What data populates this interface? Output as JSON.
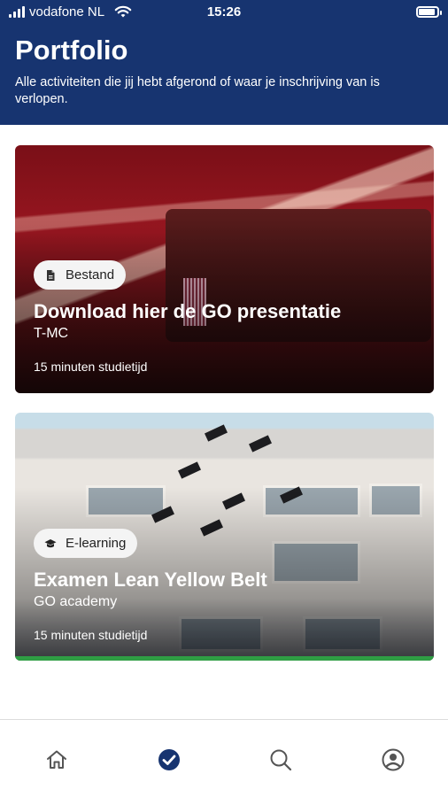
{
  "status_bar": {
    "carrier": "vodafone NL",
    "time": "15:26"
  },
  "header": {
    "title": "Portfolio",
    "subtitle": "Alle activiteiten die jij hebt afgerond of waar je inschrijving van is verlopen."
  },
  "cards": [
    {
      "badge_icon": "file-icon",
      "badge_label": "Bestand",
      "title": "Download hier de GO presentatie",
      "subtitle": "T-MC",
      "study_time": "15 minuten studietijd",
      "progress": 0
    },
    {
      "badge_icon": "graduation-cap-icon",
      "badge_label": "E-learning",
      "title": "Examen Lean Yellow Belt",
      "subtitle": "GO academy",
      "study_time": "15 minuten studietijd",
      "progress": 1.0
    }
  ],
  "bottom_nav": {
    "items": [
      "home-icon",
      "check-circle-icon",
      "search-icon",
      "profile-icon"
    ],
    "active": "check-circle-icon"
  },
  "colors": {
    "header_bg": "#173470",
    "progress": "#2f9e44",
    "nav_active": "#173470",
    "nav_inactive": "#555555"
  }
}
